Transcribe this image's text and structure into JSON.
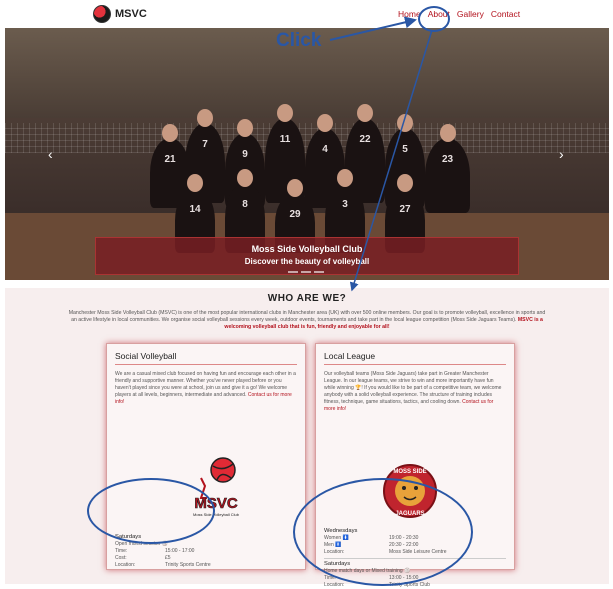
{
  "nav": {
    "brand": "MSVC",
    "links": [
      "Home",
      "About",
      "Gallery",
      "Contact"
    ]
  },
  "annotation": {
    "click_label": "Click"
  },
  "hero": {
    "caption_title": "Moss Side Volleyball Club",
    "caption_subtitle": "Discover the beauty of volleyball",
    "prev_arrow": "‹",
    "next_arrow": "›",
    "jersey_numbers": [
      "21",
      "7",
      "9",
      "11",
      "4",
      "22",
      "5",
      "23",
      "14",
      "8",
      "29",
      "3",
      "27"
    ]
  },
  "about": {
    "heading": "WHO ARE WE?",
    "intro": "Manchester Moss Side Volleyball Club (MSVC) is one of the most popular international clubs in Manchester area (UK) with over 500 online members. Our goal is to promote volleyball, excellence in sports and an active lifestyle in local communities. We organise social volleyball sessions every week, outdoor events, tournaments and take part in the local league competition (Moss Side Jaguars Teams).",
    "intro_highlight": "MSVC is a welcoming volleyball club that is fun, friendly and enjoyable for all!",
    "social": {
      "title": "Social Volleyball",
      "text": "We are a casual mixed club focused on having fun and encourage each other in a friendly and supportive manner. Whether you've never played before or you haven't played since you were at school, join us and give it a go! We welcome players at all levels, beginners, intermediate and advanced.",
      "link": "Contact us for more info!",
      "logo_text": "MSVC",
      "logo_caption": "Moss Side Volleyball Club",
      "schedule": {
        "day": "Saturdays",
        "session": "Open mixed session 🏐",
        "rows": [
          {
            "k": "Time:",
            "v": "15:00 - 17:00"
          },
          {
            "k": "Cost:",
            "v": "£5"
          },
          {
            "k": "Location:",
            "v": "Trinity Sports Centre"
          }
        ]
      }
    },
    "league": {
      "title": "Local League",
      "text": "Our volleyball teams (Moss Side Jaguars) take part in Greater Manchester League. In our league teams, we strive to win and more importantly have fun while winning 🏆! If you would like to be part of a competitive team, we welcome anybody with a solid volleyball experience. The structure of training includes fitness, technique, game situations, tactics, and cooling down.",
      "link": "Contact us for more info!",
      "badge_top": "MOSS SIDE",
      "badge_bottom": "JAGUARS",
      "schedule1": {
        "day": "Wednesdays",
        "rows": [
          {
            "k": "Women 🚺",
            "v": "19:00 - 20:30"
          },
          {
            "k": "Men 🚹",
            "v": "20:30 - 22:00"
          },
          {
            "k": "Location:",
            "v": "Moss Side Leisure Centre"
          }
        ]
      },
      "schedule2": {
        "day": "Saturdays",
        "session": "Home match days or Mixed training 🏐",
        "rows": [
          {
            "k": "Time:",
            "v": "13:00 - 15:00"
          },
          {
            "k": "Location:",
            "v": "Trinity Sports Club"
          }
        ]
      }
    }
  }
}
